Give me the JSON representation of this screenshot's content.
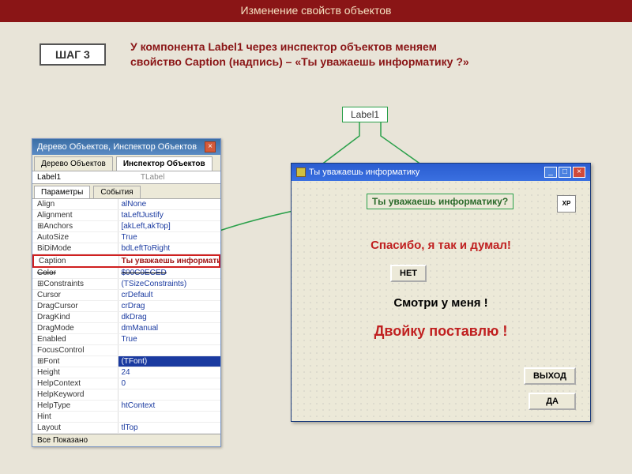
{
  "header": {
    "title": "Изменение свойств объектов"
  },
  "step": {
    "label": "ШАГ 3"
  },
  "instruction": "У компонента Label1 через инспектор объектов меняем свойство Caption (надпись) – «Ты уважаешь информатику ?»",
  "callout": {
    "label": "Label1"
  },
  "inspector": {
    "title": "Дерево Объектов, Инспектор Объектов",
    "tabs_top": [
      "Дерево Объектов",
      "Инспектор Объектов"
    ],
    "active_tab_top": 1,
    "component": {
      "name": "Label1",
      "type": "TLabel"
    },
    "tabs_mid": [
      "Параметры",
      "События"
    ],
    "active_tab_mid": 0,
    "props": [
      {
        "name": "Align",
        "value": "alNone"
      },
      {
        "name": "Alignment",
        "value": "taLeftJustify"
      },
      {
        "name": "⊞Anchors",
        "value": "[akLeft,akTop]"
      },
      {
        "name": "AutoSize",
        "value": "True"
      },
      {
        "name": "BiDiMode",
        "value": "bdLeftToRight"
      },
      {
        "name": "Caption",
        "value": "Ты уважаешь информатику?",
        "caption": true
      },
      {
        "name": "Color",
        "value": "$00C0ECED",
        "strike": true
      },
      {
        "name": "⊞Constraints",
        "value": "(TSizeConstraints)"
      },
      {
        "name": "Cursor",
        "value": "crDefault"
      },
      {
        "name": "DragCursor",
        "value": "crDrag"
      },
      {
        "name": "DragKind",
        "value": "dkDrag"
      },
      {
        "name": "DragMode",
        "value": "dmManual"
      },
      {
        "name": "Enabled",
        "value": "True"
      },
      {
        "name": "FocusControl",
        "value": ""
      },
      {
        "name": "⊞Font",
        "value": "(TFont)",
        "font": true
      },
      {
        "name": "Height",
        "value": "24"
      },
      {
        "name": "HelpContext",
        "value": "0"
      },
      {
        "name": "HelpKeyword",
        "value": ""
      },
      {
        "name": "HelpType",
        "value": "htContext"
      },
      {
        "name": "Hint",
        "value": ""
      },
      {
        "name": "Layout",
        "value": "tlTop"
      }
    ],
    "footer": "Все Показано"
  },
  "form": {
    "title": "Ты уважаешь информатику",
    "label1": "Ты уважаешь информатику?",
    "thanks": "Спасибо, я так и думал!",
    "btn_no": "НЕТ",
    "watch": "Смотри у меня !",
    "grade": "Двойку поставлю !",
    "btn_exit": "ВЫХОД",
    "btn_yes": "ДА",
    "xp": "XP"
  }
}
